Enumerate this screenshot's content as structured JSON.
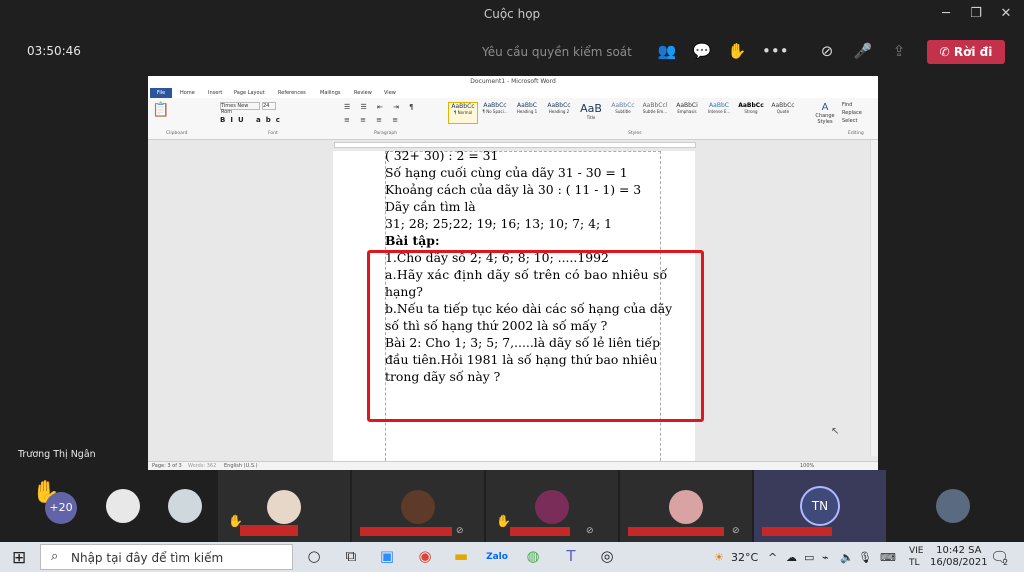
{
  "window": {
    "title": "Cuộc họp"
  },
  "meeting_bar": {
    "timer": "03:50:46",
    "request_control": "Yêu cầu quyền kiểm soát",
    "leave_label": "Rời đi",
    "icons": [
      "people-icon",
      "chat-icon",
      "raise-hand-icon",
      "more-icon",
      "camera-off-icon",
      "mic-icon",
      "share-icon"
    ]
  },
  "word": {
    "title": "Document1 - Microsoft Word",
    "tabs": [
      "File",
      "Home",
      "Insert",
      "Page Layout",
      "References",
      "Mailings",
      "Review",
      "View"
    ],
    "font_name": "Times New Rom",
    "font_size": "24",
    "styles": [
      "AaBbCc",
      "AaBbCc",
      "AaBbC",
      "AaBbCc",
      "AaB",
      "AaBbCc",
      "AaBbCcl",
      "AaBbCi",
      "AaBbC",
      "AaBbCc",
      "AaBbCc"
    ],
    "style_names": [
      "¶ Normal",
      "¶ No Spaci...",
      "Heading 1",
      "Heading 2",
      "Title",
      "Subtitle",
      "Subtle Em...",
      "Emphasis",
      "Intense E...",
      "Strong",
      "Quote"
    ],
    "groups": [
      "Clipboard",
      "Font",
      "Paragraph",
      "Styles",
      "Editing"
    ],
    "editing": [
      "Find",
      "Replace",
      "Select"
    ],
    "change_styles": "Change Styles",
    "status_page": "Page: 3 of 3",
    "status_words": "Words: 362",
    "status_lang": "English (U.S.)",
    "zoom": "100%",
    "lines": [
      "( 32+ 30) : 2 = 31",
      "Số hạng cuối cùng của dãy 31 - 30 = 1",
      "Khoảng cách của dãy là 30 : ( 11 - 1) = 3",
      "Dãy cần tìm là",
      "31; 28; 25;22; 19; 16; 13; 10; 7; 4; 1",
      "Bài tập:",
      "1.Cho dãy số 2; 4; 6; 8; 10; .....1992",
      "a.Hãy xác định dãy số trên có bao nhiêu số",
      "hạng?",
      "b.Nếu ta tiếp tục kéo dài các số hạng của dãy",
      "số thì số hạng thứ 2002 là số mấy ?",
      "Bài 2: Cho 1; 3; 5; 7,.....là dãy số lẻ liên tiếp",
      "đầu tiên.Hỏi 1981 là số hạng thứ bao nhiêu",
      "trong dãy số này ?"
    ]
  },
  "presenter_name": "Trương Thị Ngân",
  "gallery": {
    "more_count": "+20",
    "initials": "TN"
  },
  "taskbar": {
    "search_placeholder": "Nhập tại đây để tìm kiếm",
    "weather": "32°C",
    "lang_top": "VIE",
    "lang_bottom": "TL",
    "time": "10:42 SA",
    "date": "16/08/2021",
    "notif_count": "2"
  }
}
